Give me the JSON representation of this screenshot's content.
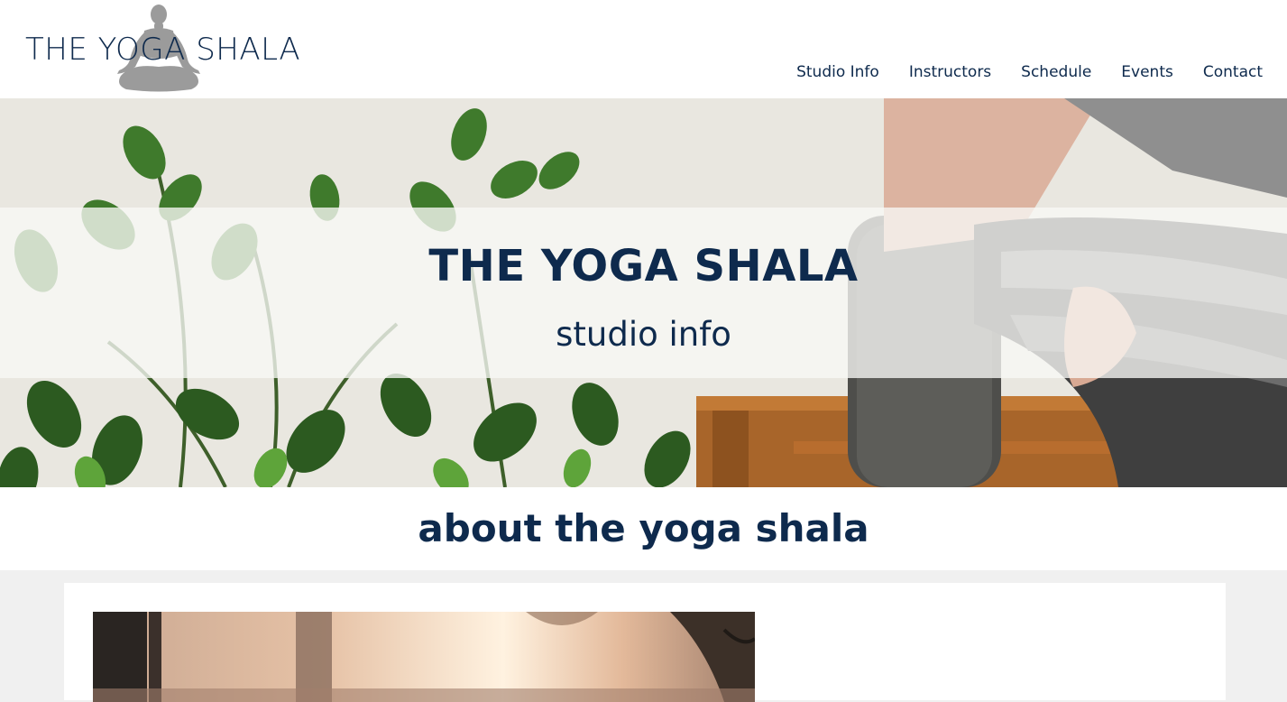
{
  "brand": {
    "logo_text": "THE YOGA SHALA",
    "logo_icon": "meditation-figure-icon"
  },
  "nav": {
    "items": [
      {
        "label": "Studio Info"
      },
      {
        "label": "Instructors"
      },
      {
        "label": "Schedule"
      },
      {
        "label": "Events"
      },
      {
        "label": "Contact"
      }
    ]
  },
  "hero": {
    "title": "THE YOGA SHALA",
    "subtitle": "studio info"
  },
  "about": {
    "heading": "about the yoga shala"
  },
  "colors": {
    "primary_text": "#0e2a4d",
    "header_bg": "#ffffff",
    "page_bg": "#f0f0f0"
  }
}
